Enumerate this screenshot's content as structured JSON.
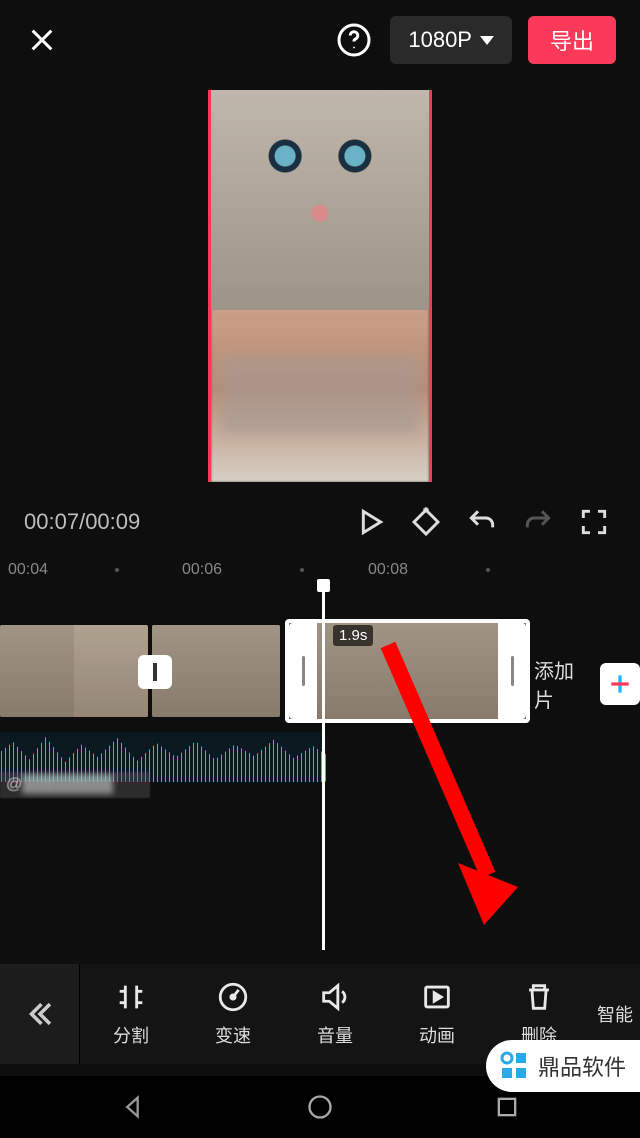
{
  "header": {
    "resolution": "1080P",
    "export_label": "导出"
  },
  "playback": {
    "current_time": "00:07",
    "total_time": "00:09"
  },
  "ruler": {
    "ticks": [
      "00:04",
      "00:06",
      "00:08"
    ]
  },
  "timeline": {
    "selected_clip_duration": "1.9s",
    "add_clip_label": "添加片",
    "audio_label_prefix": "@"
  },
  "toolbar": {
    "items": [
      {
        "label": "分割"
      },
      {
        "label": "变速"
      },
      {
        "label": "音量"
      },
      {
        "label": "动画"
      },
      {
        "label": "删除"
      },
      {
        "label": "智能"
      }
    ]
  },
  "watermark": {
    "text": "鼎品软件"
  }
}
